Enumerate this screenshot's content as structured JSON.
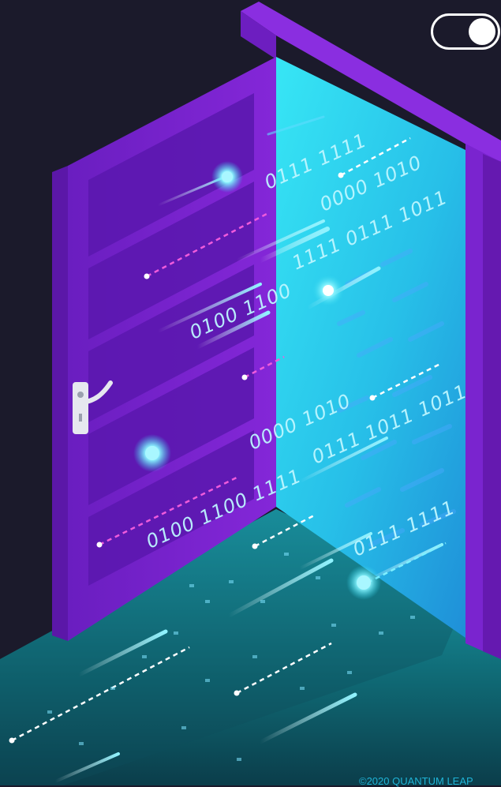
{
  "binary": {
    "b1": "0111 1111",
    "b2": "0000 1010",
    "b3": "1111 0111 1011",
    "b4": "0100 1100",
    "b5": "0000 1010",
    "b6": "0111 1011 1011",
    "b7": "0100 1100 1111",
    "b8": "0111 1111"
  },
  "toggle": {
    "state": "on"
  },
  "footer": {
    "copyright": "©2020 QUANTUM LEAP"
  },
  "colors": {
    "background": "#1b1a2b",
    "door_purple": "#7c22cf",
    "portal_cyan": "#2fd6ee",
    "floor_teal": "#0f6f78"
  },
  "icons": {
    "toggle": "toggle-switch-icon",
    "handle": "door-handle-icon"
  }
}
